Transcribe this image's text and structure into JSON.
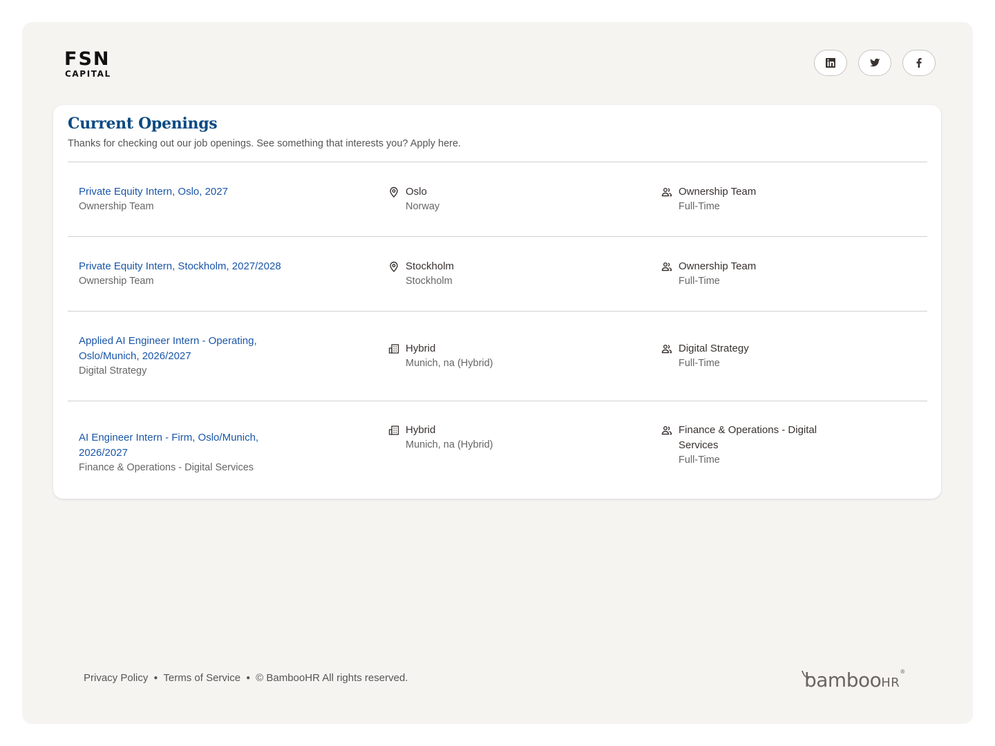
{
  "brand": {
    "name": "FSN",
    "sub": "CAPITAL"
  },
  "social": [
    {
      "icon": "linkedin-icon"
    },
    {
      "icon": "twitter-icon"
    },
    {
      "icon": "facebook-icon"
    }
  ],
  "card": {
    "title": "Current Openings",
    "subtitle": "Thanks for checking out our job openings. See something that interests you? Apply here."
  },
  "jobs": [
    {
      "title_lines": [
        "Private Equity Intern, Oslo, 2027"
      ],
      "department": "Ownership Team",
      "location_icon": "map-pin-icon",
      "location": "Oslo",
      "location_sub": "Norway",
      "team_lines": [
        "Ownership Team"
      ],
      "employment": "Full-Time"
    },
    {
      "title_lines": [
        "Private Equity Intern, Stockholm, 2027/2028"
      ],
      "department": "Ownership Team",
      "location_icon": "map-pin-icon",
      "location": "Stockholm",
      "location_sub": "Stockholm",
      "team_lines": [
        "Ownership Team"
      ],
      "employment": "Full-Time"
    },
    {
      "title_lines": [
        "Applied AI Engineer Intern - Operating,",
        "Oslo/Munich, 2026/2027"
      ],
      "department": "Digital Strategy",
      "location_icon": "building-icon",
      "location": "Hybrid",
      "location_sub": "Munich, na (Hybrid)",
      "team_lines": [
        "Digital Strategy"
      ],
      "employment": "Full-Time"
    },
    {
      "title_lines": [
        "AI Engineer Intern - Firm, Oslo/Munich, 2026/2027"
      ],
      "department": "Finance & Operations - Digital Services",
      "location_icon": "building-icon",
      "location": "Hybrid",
      "location_sub": "Munich, na (Hybrid)",
      "team_lines": [
        "Finance & Operations - Digital",
        "Services"
      ],
      "employment": "Full-Time"
    }
  ],
  "footer": {
    "privacy": "Privacy Policy",
    "terms": "Terms of Service",
    "copyright": "© BambooHR All rights reserved.",
    "separator": "●",
    "powered_logo": "bamboo",
    "powered_logo_hr": "HR",
    "powered_logo_tm": "®"
  }
}
